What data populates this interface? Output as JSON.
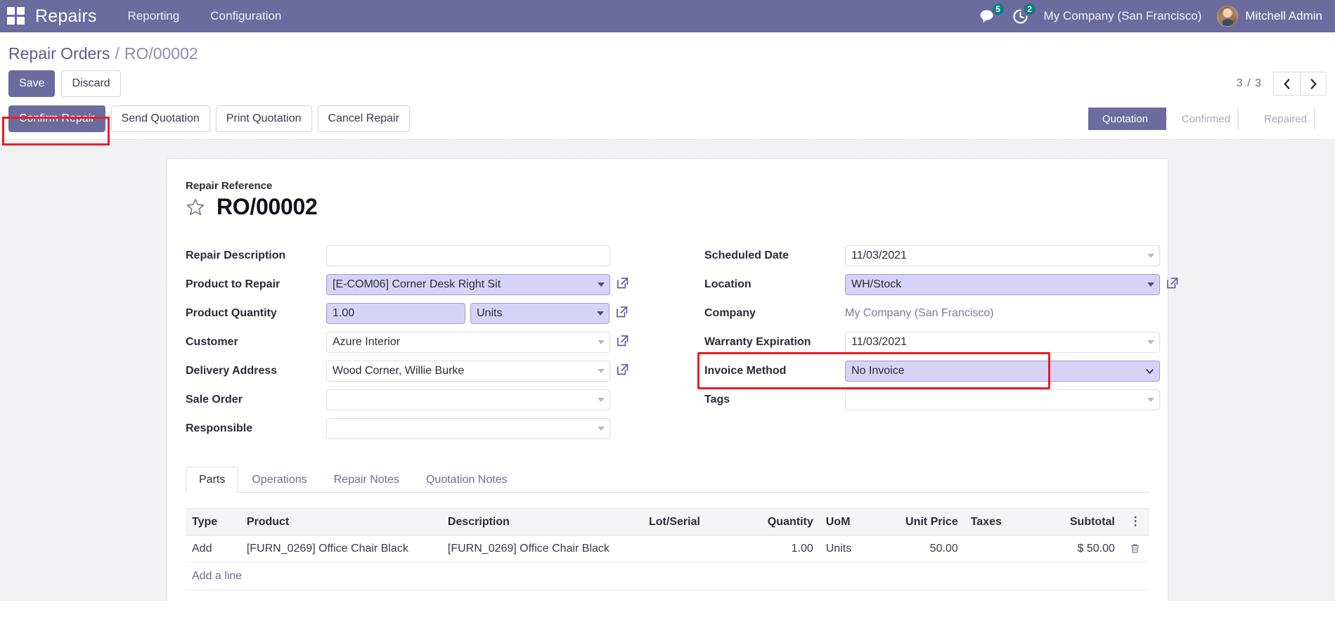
{
  "navbar": {
    "apps_icon": "apps-grid-icon",
    "brand": "Repairs",
    "menu": [
      {
        "label": "Reporting"
      },
      {
        "label": "Configuration"
      }
    ],
    "messages_icon": "messages-icon",
    "messages_count": "5",
    "activities_icon": "activities-clock-icon",
    "activities_count": "2",
    "company": "My Company (San Francisco)",
    "user": "Mitchell Admin",
    "accent": "#6b6b9e",
    "badge_color": "#0c7e7e"
  },
  "breadcrumb": {
    "root": "Repair Orders",
    "separator": "/",
    "current": "RO/00002"
  },
  "control_panel": {
    "save_label": "Save",
    "discard_label": "Discard",
    "pager_value": "3 / 3",
    "prev_icon": "chevron-left-icon",
    "next_icon": "chevron-right-icon"
  },
  "action_bar": {
    "buttons": [
      {
        "label": "Confirm Repair",
        "style": "primary",
        "highlighted": true
      },
      {
        "label": "Send Quotation",
        "style": "default",
        "highlighted": false
      },
      {
        "label": "Print Quotation",
        "style": "default",
        "highlighted": false
      },
      {
        "label": "Cancel Repair",
        "style": "default",
        "highlighted": false
      }
    ],
    "statusbar": [
      {
        "label": "Quotation",
        "active": true
      },
      {
        "label": "Confirmed",
        "active": false
      },
      {
        "label": "Repaired",
        "active": false
      }
    ]
  },
  "form": {
    "title_label": "Repair Reference",
    "star_icon": "star-favorite-icon",
    "title_value": "RO/00002",
    "left_fields": [
      {
        "label": "Repair Description",
        "value": "",
        "placeholder": "",
        "widget": "text",
        "highlighted": false,
        "has_caret": false,
        "has_external_link": false
      },
      {
        "label": "Product to Repair",
        "value": "[E-COM06] Corner Desk Right Sit",
        "widget": "many2one",
        "highlighted": true,
        "has_caret": true,
        "has_external_link": true
      },
      {
        "label": "Product Quantity",
        "value": "1.00",
        "value2": "Units",
        "widget": "quantity-uom",
        "highlighted": true,
        "has_caret": true,
        "has_external_link": true
      },
      {
        "label": "Customer",
        "value": "Azure Interior",
        "widget": "many2one",
        "highlighted": false,
        "has_caret": true,
        "has_external_link": true
      },
      {
        "label": "Delivery Address",
        "value": "Wood Corner, Willie Burke",
        "widget": "many2one",
        "highlighted": false,
        "has_caret": true,
        "has_external_link": true
      },
      {
        "label": "Sale Order",
        "value": "",
        "widget": "many2one",
        "highlighted": false,
        "has_caret": true,
        "has_external_link": false
      },
      {
        "label": "Responsible",
        "value": "",
        "widget": "many2one",
        "highlighted": false,
        "has_caret": true,
        "has_external_link": false
      }
    ],
    "right_fields": [
      {
        "label": "Scheduled Date",
        "value": "11/03/2021",
        "widget": "date",
        "highlighted": false,
        "has_caret": true,
        "has_external_link": false
      },
      {
        "label": "Location",
        "value": "WH/Stock",
        "widget": "many2one",
        "highlighted": true,
        "has_caret": true,
        "has_external_link": true
      },
      {
        "label": "Company",
        "value": "My Company (San Francisco)",
        "widget": "readonly",
        "highlighted": false,
        "has_caret": false,
        "has_external_link": false
      },
      {
        "label": "Warranty Expiration",
        "value": "11/03/2021",
        "widget": "date",
        "highlighted": false,
        "has_caret": true,
        "has_external_link": false
      },
      {
        "label": "Invoice Method",
        "value": "No Invoice",
        "widget": "select",
        "highlighted": true,
        "has_caret": true,
        "has_external_link": false,
        "annotated": true
      },
      {
        "label": "Tags",
        "value": "",
        "widget": "many2many",
        "highlighted": false,
        "has_caret": true,
        "has_external_link": false
      }
    ]
  },
  "notebook": {
    "tabs": [
      {
        "label": "Parts",
        "active": true
      },
      {
        "label": "Operations",
        "active": false
      },
      {
        "label": "Repair Notes",
        "active": false
      },
      {
        "label": "Quotation Notes",
        "active": false
      }
    ],
    "table": {
      "columns": [
        {
          "label": "Type",
          "align": "left"
        },
        {
          "label": "Product",
          "align": "left"
        },
        {
          "label": "Description",
          "align": "left"
        },
        {
          "label": "Lot/Serial",
          "align": "left"
        },
        {
          "label": "Quantity",
          "align": "right"
        },
        {
          "label": "UoM",
          "align": "left"
        },
        {
          "label": "Unit Price",
          "align": "right"
        },
        {
          "label": "Taxes",
          "align": "left"
        },
        {
          "label": "Subtotal",
          "align": "right"
        },
        {
          "label": "",
          "align": "center",
          "icon": "optional-columns-dots-icon"
        }
      ],
      "rows": [
        {
          "type": "Add",
          "product": "[FURN_0269] Office Chair Black",
          "description": "[FURN_0269] Office Chair Black",
          "lot_serial": "",
          "quantity": "1.00",
          "uom": "Units",
          "unit_price": "50.00",
          "taxes": "",
          "subtotal": "$ 50.00",
          "delete_icon": "trash-icon"
        }
      ],
      "add_line_label": "Add a line"
    }
  },
  "annotations": {
    "color": "#ec1c24",
    "boxes": [
      {
        "name": "confirm-repair-highlight"
      },
      {
        "name": "invoice-method-highlight"
      }
    ]
  }
}
